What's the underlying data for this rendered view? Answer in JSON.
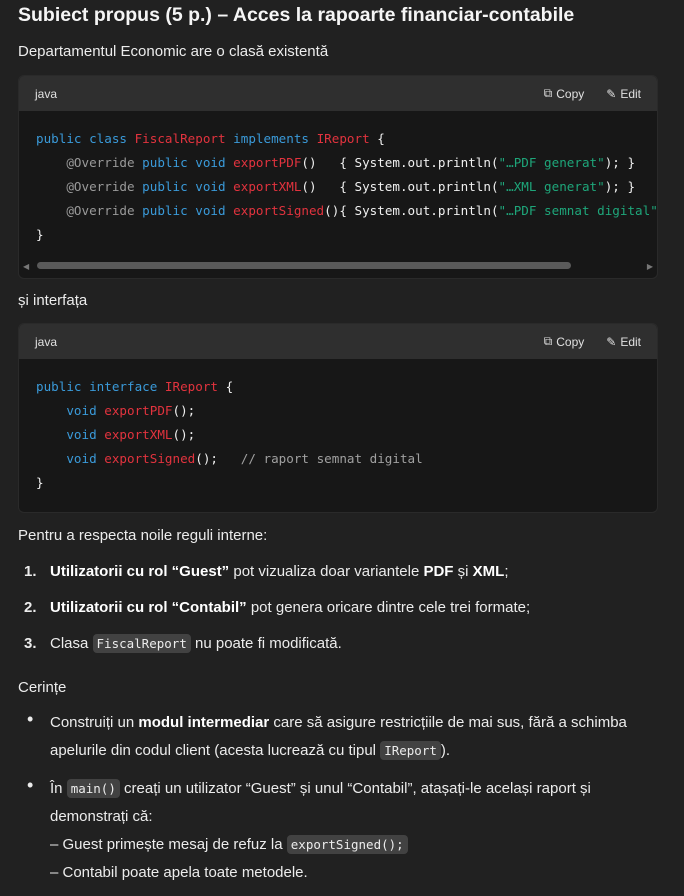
{
  "title": "Subiect propus (5 p.) – Acces la rapoarte financiar-contabile",
  "intro": "Departamentul Economic are o clasă existentă",
  "code_blocks": [
    {
      "lang": "java",
      "copy": "Copy",
      "edit": "Edit",
      "lines": [
        [
          [
            "public class ",
            "kw"
          ],
          [
            "FiscalReport",
            "ty"
          ],
          [
            " implements ",
            "kw"
          ],
          [
            "IReport",
            "ty"
          ],
          [
            " {",
            "pl"
          ]
        ],
        [
          [
            "    @Override ",
            "an"
          ],
          [
            "public void ",
            "kw"
          ],
          [
            "exportPDF",
            "ty"
          ],
          [
            "()   { System.out.println(",
            "pl"
          ],
          [
            "\"…PDF generat\"",
            "st"
          ],
          [
            "); }",
            "pl"
          ]
        ],
        [
          [
            "    @Override ",
            "an"
          ],
          [
            "public void ",
            "kw"
          ],
          [
            "exportXML",
            "ty"
          ],
          [
            "()   { System.out.println(",
            "pl"
          ],
          [
            "\"…XML generat\"",
            "st"
          ],
          [
            "); }",
            "pl"
          ]
        ],
        [
          [
            "    @Override ",
            "an"
          ],
          [
            "public void ",
            "kw"
          ],
          [
            "exportSigned",
            "ty"
          ],
          [
            "(){ System.out.println(",
            "pl"
          ],
          [
            "\"…PDF semnat digital\"",
            "st"
          ],
          [
            "); }",
            "pl"
          ]
        ],
        [
          [
            "}",
            "pl"
          ]
        ]
      ]
    },
    {
      "lang": "java",
      "copy": "Copy",
      "edit": "Edit",
      "lines": [
        [
          [
            "public interface ",
            "kw"
          ],
          [
            "IReport",
            "ty"
          ],
          [
            " {",
            "pl"
          ]
        ],
        [
          [
            "    void ",
            "kw"
          ],
          [
            "exportPDF",
            "ty"
          ],
          [
            "();",
            "pl"
          ]
        ],
        [
          [
            "    void ",
            "kw"
          ],
          [
            "exportXML",
            "ty"
          ],
          [
            "();",
            "pl"
          ]
        ],
        [
          [
            "    void ",
            "kw"
          ],
          [
            "exportSigned",
            "ty"
          ],
          [
            "();   ",
            "pl"
          ],
          [
            "// raport semnat digital",
            "cm"
          ]
        ],
        [
          [
            "}",
            "pl"
          ]
        ]
      ]
    }
  ],
  "between": "și interfața",
  "rules_intro": "Pentru a respecta noile reguli interne:",
  "rules": [
    {
      "n": "1.",
      "b": "Utilizatorii cu rol “Guest”",
      "t": " pot vizualiza doar variantele ",
      "b2": "PDF",
      "t2": " și ",
      "b3": "XML",
      "t3": ";"
    },
    {
      "n": "2.",
      "b": "Utilizatorii cu rol “Contabil”",
      "t": " pot genera oricare dintre cele trei formate;"
    },
    {
      "n": "3.",
      "t": "Clasa ",
      "code": "FiscalReport",
      "t2": " nu poate fi modificată."
    }
  ],
  "req_title": "Cerințe",
  "req": [
    {
      "t": "Construiți un ",
      "b": "modul intermediar",
      "t2": " care să asigure restricțiile de mai sus, fără a schimba",
      "t3": "apelurile din codul client (acesta lucrează cu tipul ",
      "code": "IReport",
      "t4": ")."
    },
    {
      "t": "În ",
      "code": "main()",
      "t2": " creați un utilizator “Guest” și unul “Contabil”, atașați-le același raport și",
      "t3": "demonstrați că:",
      "t4": "– Guest primește mesaj de refuz la ",
      "code2": "exportSigned();",
      "t5": "– Contabil poate apela toate metodele."
    }
  ]
}
